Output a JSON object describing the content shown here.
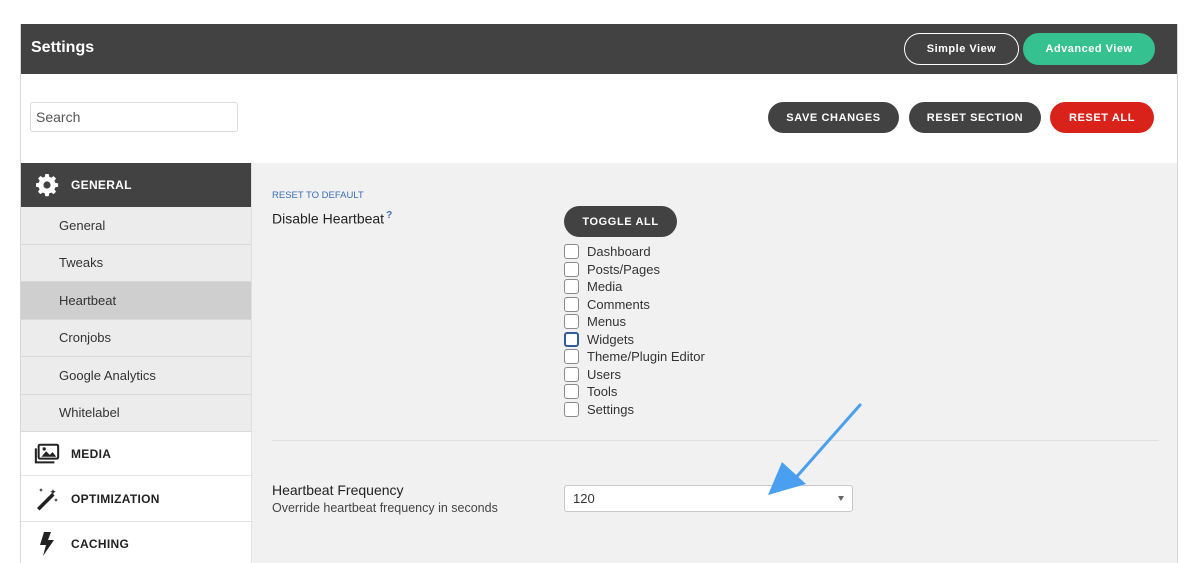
{
  "header": {
    "title": "Settings",
    "simple_view": "Simple View",
    "advanced_view": "Advanced View"
  },
  "toolbar": {
    "search_placeholder": "Search",
    "save_label": "SAVE CHANGES",
    "reset_section_label": "RESET SECTION",
    "reset_all_label": "RESET ALL"
  },
  "sidebar": {
    "general": {
      "label": "GENERAL",
      "icon": "gear-icon",
      "items": [
        {
          "label": "General"
        },
        {
          "label": "Tweaks"
        },
        {
          "label": "Heartbeat"
        },
        {
          "label": "Cronjobs"
        },
        {
          "label": "Google Analytics"
        },
        {
          "label": "Whitelabel"
        }
      ]
    },
    "media": {
      "label": "MEDIA",
      "icon": "images-icon"
    },
    "optimization": {
      "label": "OPTIMIZATION",
      "icon": "magic-wand-icon"
    },
    "caching": {
      "label": "CACHING",
      "icon": "lightning-icon"
    }
  },
  "main": {
    "reset_default": "RESET TO DEFAULT",
    "disable_heartbeat": {
      "label": "Disable Heartbeat",
      "help": "?",
      "toggle_all": "TOGGLE ALL",
      "options": [
        {
          "label": "Dashboard",
          "checked": false
        },
        {
          "label": "Posts/Pages",
          "checked": false
        },
        {
          "label": "Media",
          "checked": false
        },
        {
          "label": "Comments",
          "checked": false
        },
        {
          "label": "Menus",
          "checked": false
        },
        {
          "label": "Widgets",
          "checked": false,
          "focused": true
        },
        {
          "label": "Theme/Plugin Editor",
          "checked": false
        },
        {
          "label": "Users",
          "checked": false
        },
        {
          "label": "Tools",
          "checked": false
        },
        {
          "label": "Settings",
          "checked": false
        }
      ]
    },
    "heartbeat_frequency": {
      "label": "Heartbeat Frequency",
      "description": "Override heartbeat frequency in seconds",
      "value": "120"
    }
  },
  "colors": {
    "dark": "#424242",
    "accent_green": "#35c190",
    "danger_red": "#d9231a",
    "link_blue": "#3a6fb5",
    "annotation_arrow": "#4a9ff0"
  }
}
